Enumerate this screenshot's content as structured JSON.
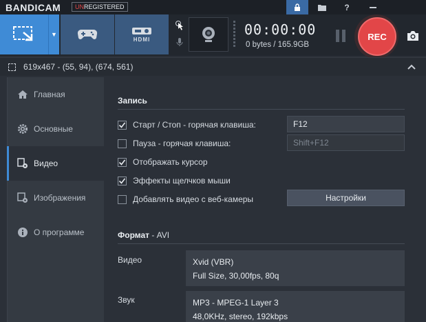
{
  "titlebar": {
    "logo": "BANDICAM",
    "unregistered_prefix": "UN",
    "unregistered_rest": "REGISTERED",
    "icons": [
      "lock-icon",
      "folder-icon",
      "help-icon",
      "minimize-icon"
    ]
  },
  "toolbar": {
    "timer": "00:00:00",
    "size": "0 bytes / 165.9GB",
    "rec_label": "REC",
    "hdmi_label": "HDMI"
  },
  "infobar": {
    "coords": "619x467 - (55, 94), (674, 561)"
  },
  "sidebar": {
    "items": [
      {
        "label": "Главная",
        "icon": "home-icon"
      },
      {
        "label": "Основные",
        "icon": "gear-icon"
      },
      {
        "label": "Видео",
        "icon": "video-settings-icon"
      },
      {
        "label": "Изображения",
        "icon": "image-icon"
      },
      {
        "label": "О программе",
        "icon": "info-icon"
      }
    ]
  },
  "record": {
    "title": "Запись",
    "rows": [
      {
        "label": "Старт / Стоп - горячая клавиша:",
        "checked": true
      },
      {
        "label": "Пауза - горячая клавиша:",
        "checked": false
      },
      {
        "label": "Отображать курсор",
        "checked": true
      },
      {
        "label": "Эффекты щелчков мыши",
        "checked": true
      },
      {
        "label": "Добавлять видео с веб-камеры",
        "checked": false
      }
    ],
    "hotkey_start": "F12",
    "hotkey_pause": "Shift+F12",
    "settings_button": "Настройки"
  },
  "format": {
    "title": "Формат",
    "subtitle": " - AVI",
    "video_label": "Видео",
    "video_line1": "Xvid (VBR)",
    "video_line2": "Full Size, 30,00fps, 80q",
    "audio_label": "Звук",
    "audio_line1": "MP3 - MPEG-1 Layer 3",
    "audio_line2": "48,0KHz, stereo, 192kbps"
  },
  "colors": {
    "accent": "#3f8bd6",
    "rec": "#e24648",
    "background": "#2b3038"
  }
}
